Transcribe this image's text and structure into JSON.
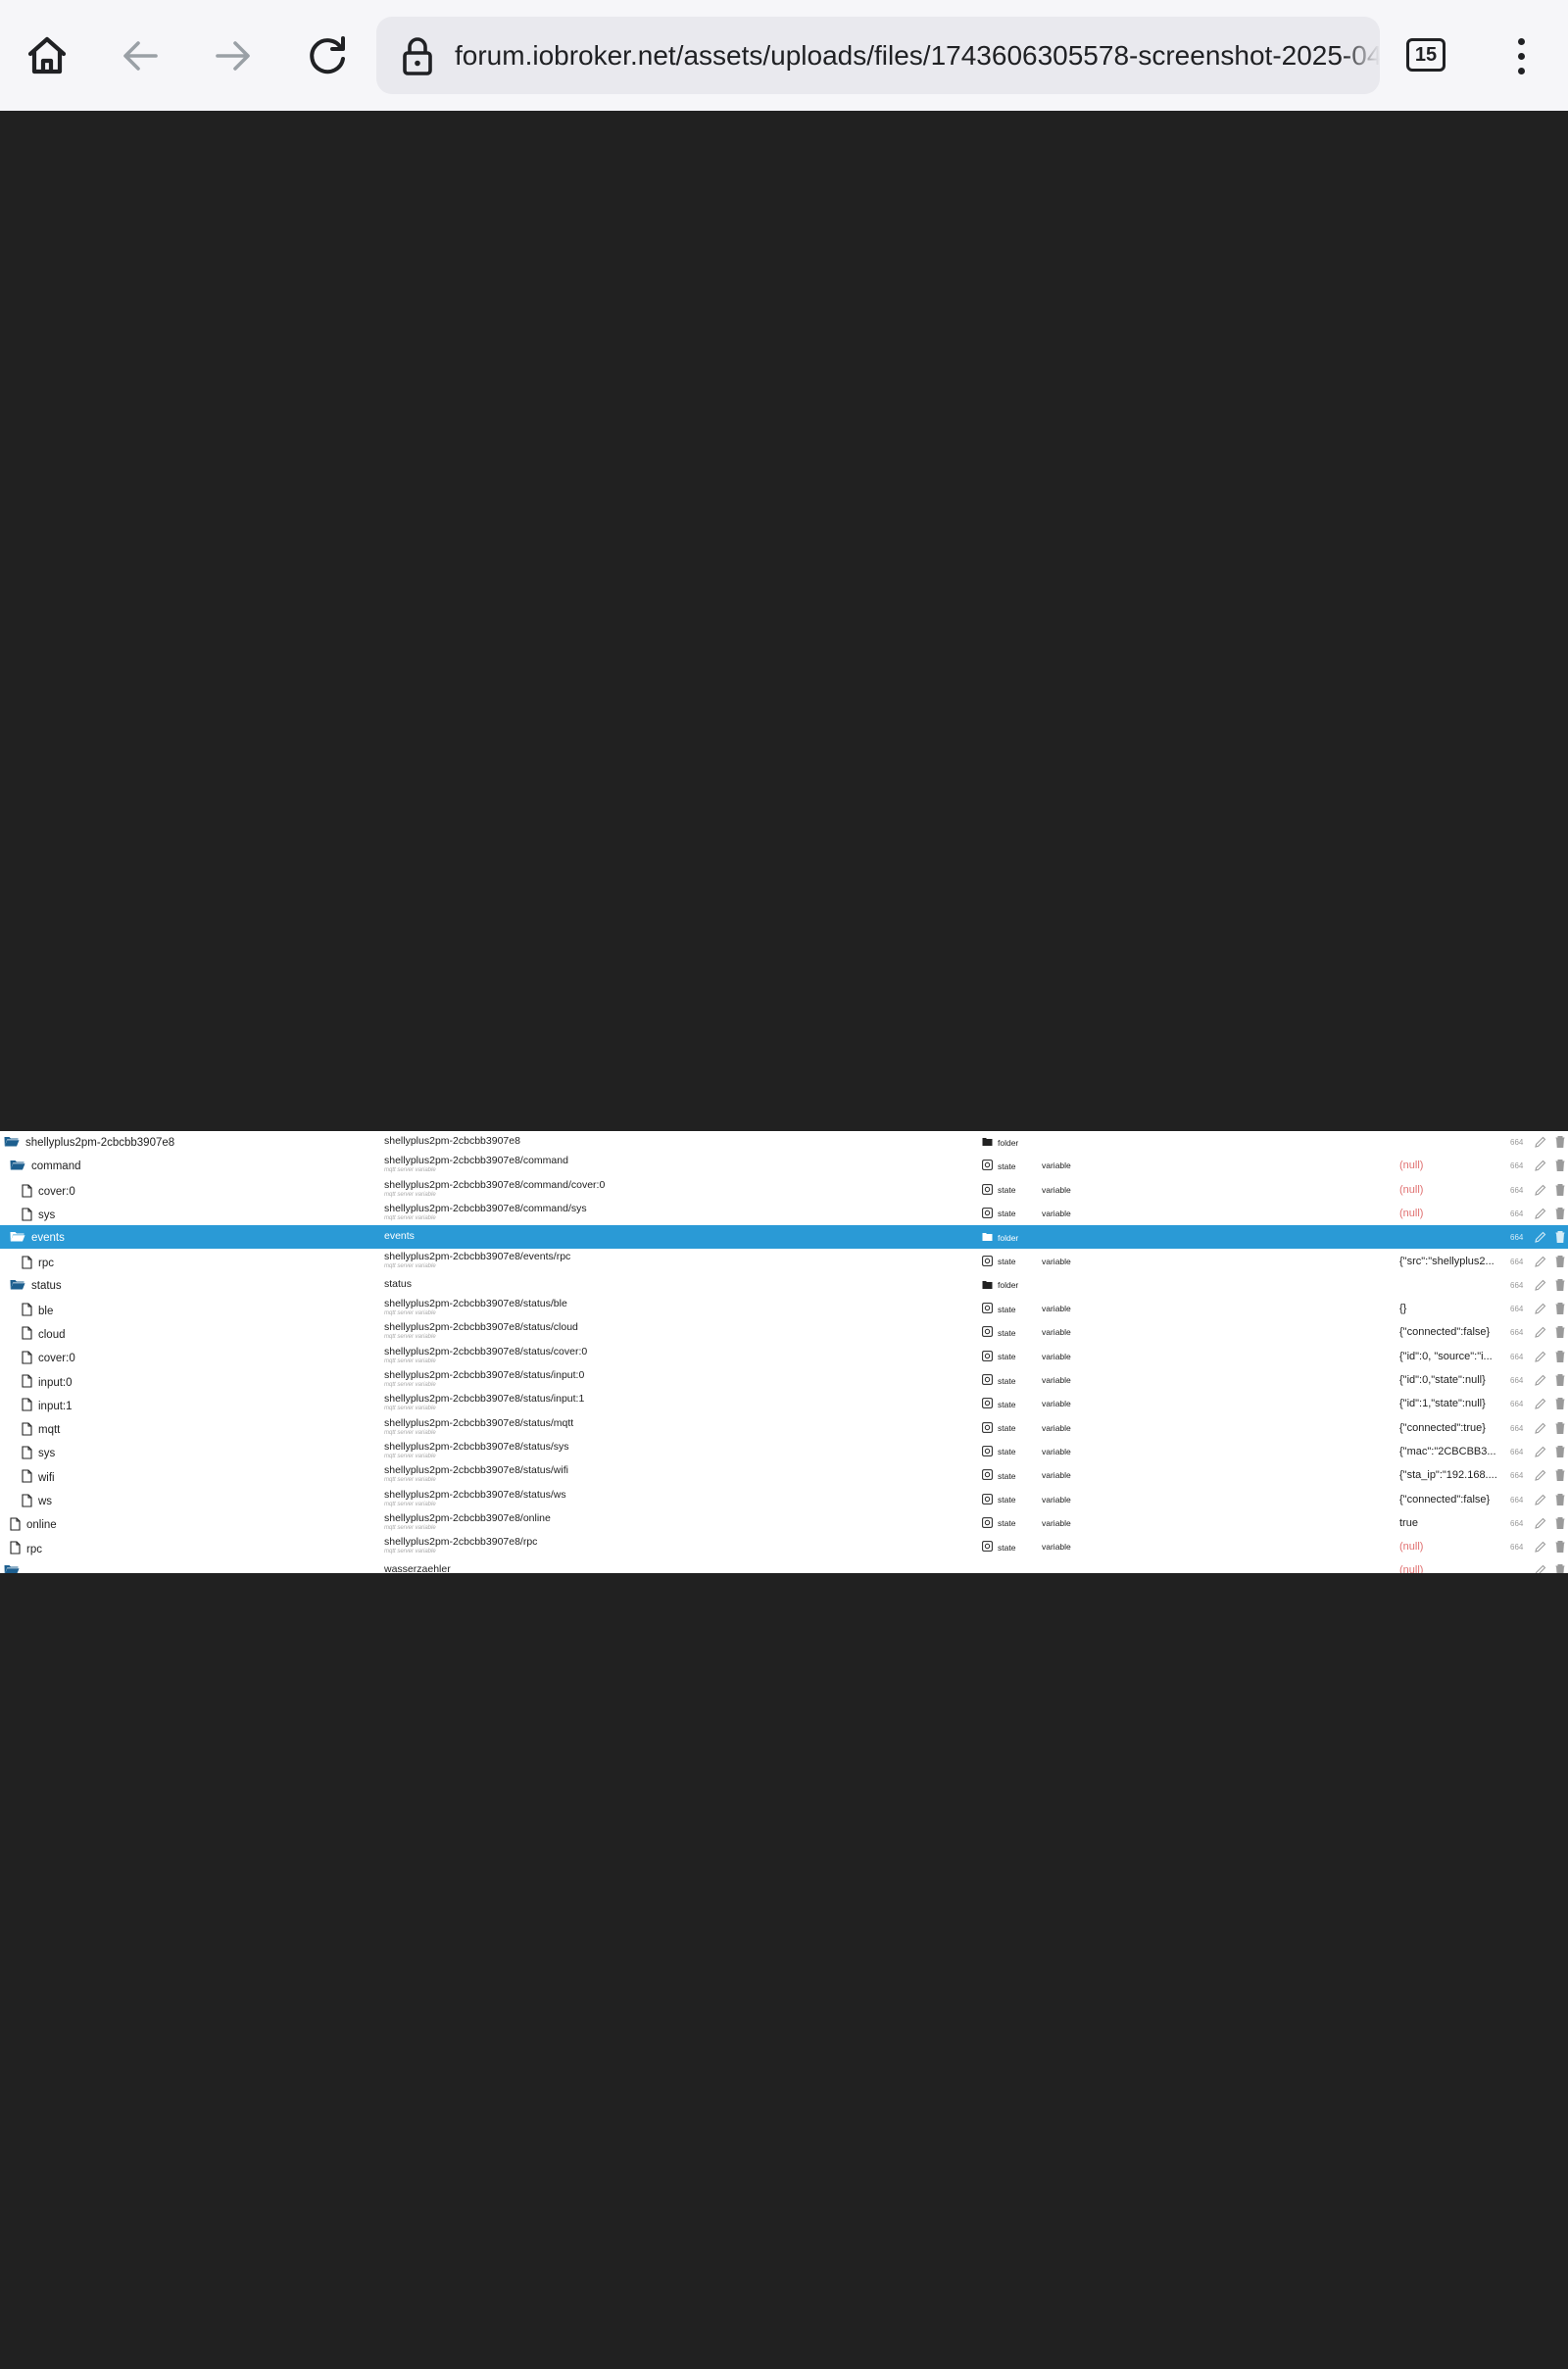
{
  "browser": {
    "url": "forum.iobroker.net/assets/uploads/files/1743606305578-screenshot-2025-04-",
    "tab_count": "15",
    "icons": [
      "home-icon",
      "back-icon",
      "forward-icon",
      "reload-icon",
      "lock-icon",
      "tabs-icon",
      "more-vert-icon"
    ]
  },
  "colors": {
    "selected_row": "#2a9ad6",
    "null_value": "#e07070",
    "viewer_bg": "#212121"
  },
  "object_tree": {
    "rows": [
      {
        "name": "shellyplus2pm-2cbcbb3907e8",
        "icon": "folder-open",
        "indent": 0,
        "id": "shellyplus2pm-2cbcbb3907e8",
        "sub": "",
        "type": "folder",
        "role": "",
        "value": "",
        "acl": "664"
      },
      {
        "name": "command",
        "icon": "folder-open",
        "indent": 1,
        "id": "shellyplus2pm-2cbcbb3907e8/command",
        "sub": "mqtt server variable",
        "type": "state",
        "role": "variable",
        "value": "(null)",
        "acl": "664"
      },
      {
        "name": "cover:0",
        "icon": "file",
        "indent": 2,
        "id": "shellyplus2pm-2cbcbb3907e8/command/cover:0",
        "sub": "mqtt server variable",
        "type": "state",
        "role": "variable",
        "value": "(null)",
        "acl": "664"
      },
      {
        "name": "sys",
        "icon": "file",
        "indent": 2,
        "id": "shellyplus2pm-2cbcbb3907e8/command/sys",
        "sub": "mqtt server variable",
        "type": "state",
        "role": "variable",
        "value": "(null)",
        "acl": "664"
      },
      {
        "name": "events",
        "icon": "folder-open",
        "indent": 1,
        "id": "events",
        "sub": "",
        "type": "folder",
        "role": "",
        "value": "",
        "acl": "664",
        "selected": true
      },
      {
        "name": "rpc",
        "icon": "file",
        "indent": 2,
        "id": "shellyplus2pm-2cbcbb3907e8/events/rpc",
        "sub": "mqtt server variable",
        "type": "state",
        "role": "variable",
        "value": "{\"src\":\"shellyplus2...",
        "acl": "664"
      },
      {
        "name": "status",
        "icon": "folder-open",
        "indent": 1,
        "id": "status",
        "sub": "",
        "type": "folder",
        "role": "",
        "value": "",
        "acl": "664"
      },
      {
        "name": "ble",
        "icon": "file",
        "indent": 2,
        "id": "shellyplus2pm-2cbcbb3907e8/status/ble",
        "sub": "mqtt server variable",
        "type": "state",
        "role": "variable",
        "value": "{}",
        "acl": "664"
      },
      {
        "name": "cloud",
        "icon": "file",
        "indent": 2,
        "id": "shellyplus2pm-2cbcbb3907e8/status/cloud",
        "sub": "mqtt server variable",
        "type": "state",
        "role": "variable",
        "value": "{\"connected\":false}",
        "acl": "664"
      },
      {
        "name": "cover:0",
        "icon": "file",
        "indent": 2,
        "id": "shellyplus2pm-2cbcbb3907e8/status/cover:0",
        "sub": "mqtt server variable",
        "type": "state",
        "role": "variable",
        "value": "{\"id\":0, \"source\":\"i...",
        "acl": "664"
      },
      {
        "name": "input:0",
        "icon": "file",
        "indent": 2,
        "id": "shellyplus2pm-2cbcbb3907e8/status/input:0",
        "sub": "mqtt server variable",
        "type": "state",
        "role": "variable",
        "value": "{\"id\":0,\"state\":null}",
        "acl": "664"
      },
      {
        "name": "input:1",
        "icon": "file",
        "indent": 2,
        "id": "shellyplus2pm-2cbcbb3907e8/status/input:1",
        "sub": "mqtt server variable",
        "type": "state",
        "role": "variable",
        "value": "{\"id\":1,\"state\":null}",
        "acl": "664"
      },
      {
        "name": "mqtt",
        "icon": "file",
        "indent": 2,
        "id": "shellyplus2pm-2cbcbb3907e8/status/mqtt",
        "sub": "mqtt server variable",
        "type": "state",
        "role": "variable",
        "value": "{\"connected\":true}",
        "acl": "664"
      },
      {
        "name": "sys",
        "icon": "file",
        "indent": 2,
        "id": "shellyplus2pm-2cbcbb3907e8/status/sys",
        "sub": "mqtt server variable",
        "type": "state",
        "role": "variable",
        "value": "{\"mac\":\"2CBCBB3...",
        "acl": "664"
      },
      {
        "name": "wifi",
        "icon": "file",
        "indent": 2,
        "id": "shellyplus2pm-2cbcbb3907e8/status/wifi",
        "sub": "mqtt server variable",
        "type": "state",
        "role": "variable",
        "value": "{\"sta_ip\":\"192.168....",
        "acl": "664"
      },
      {
        "name": "ws",
        "icon": "file",
        "indent": 2,
        "id": "shellyplus2pm-2cbcbb3907e8/status/ws",
        "sub": "mqtt server variable",
        "type": "state",
        "role": "variable",
        "value": "{\"connected\":false}",
        "acl": "664"
      },
      {
        "name": "online",
        "icon": "file",
        "indent": 1,
        "id": "shellyplus2pm-2cbcbb3907e8/online",
        "sub": "mqtt server variable",
        "type": "state",
        "role": "variable",
        "value": "true",
        "acl": "664"
      },
      {
        "name": "rpc",
        "icon": "file",
        "indent": 1,
        "id": "shellyplus2pm-2cbcbb3907e8/rpc",
        "sub": "mqtt server variable",
        "type": "state",
        "role": "variable",
        "value": "(null)",
        "acl": "664"
      },
      {
        "name": "",
        "icon": "folder-open",
        "indent": 0,
        "id": "wasserzaehler",
        "sub": "",
        "type": "",
        "role": "",
        "value": "(null)",
        "acl": ""
      }
    ]
  }
}
